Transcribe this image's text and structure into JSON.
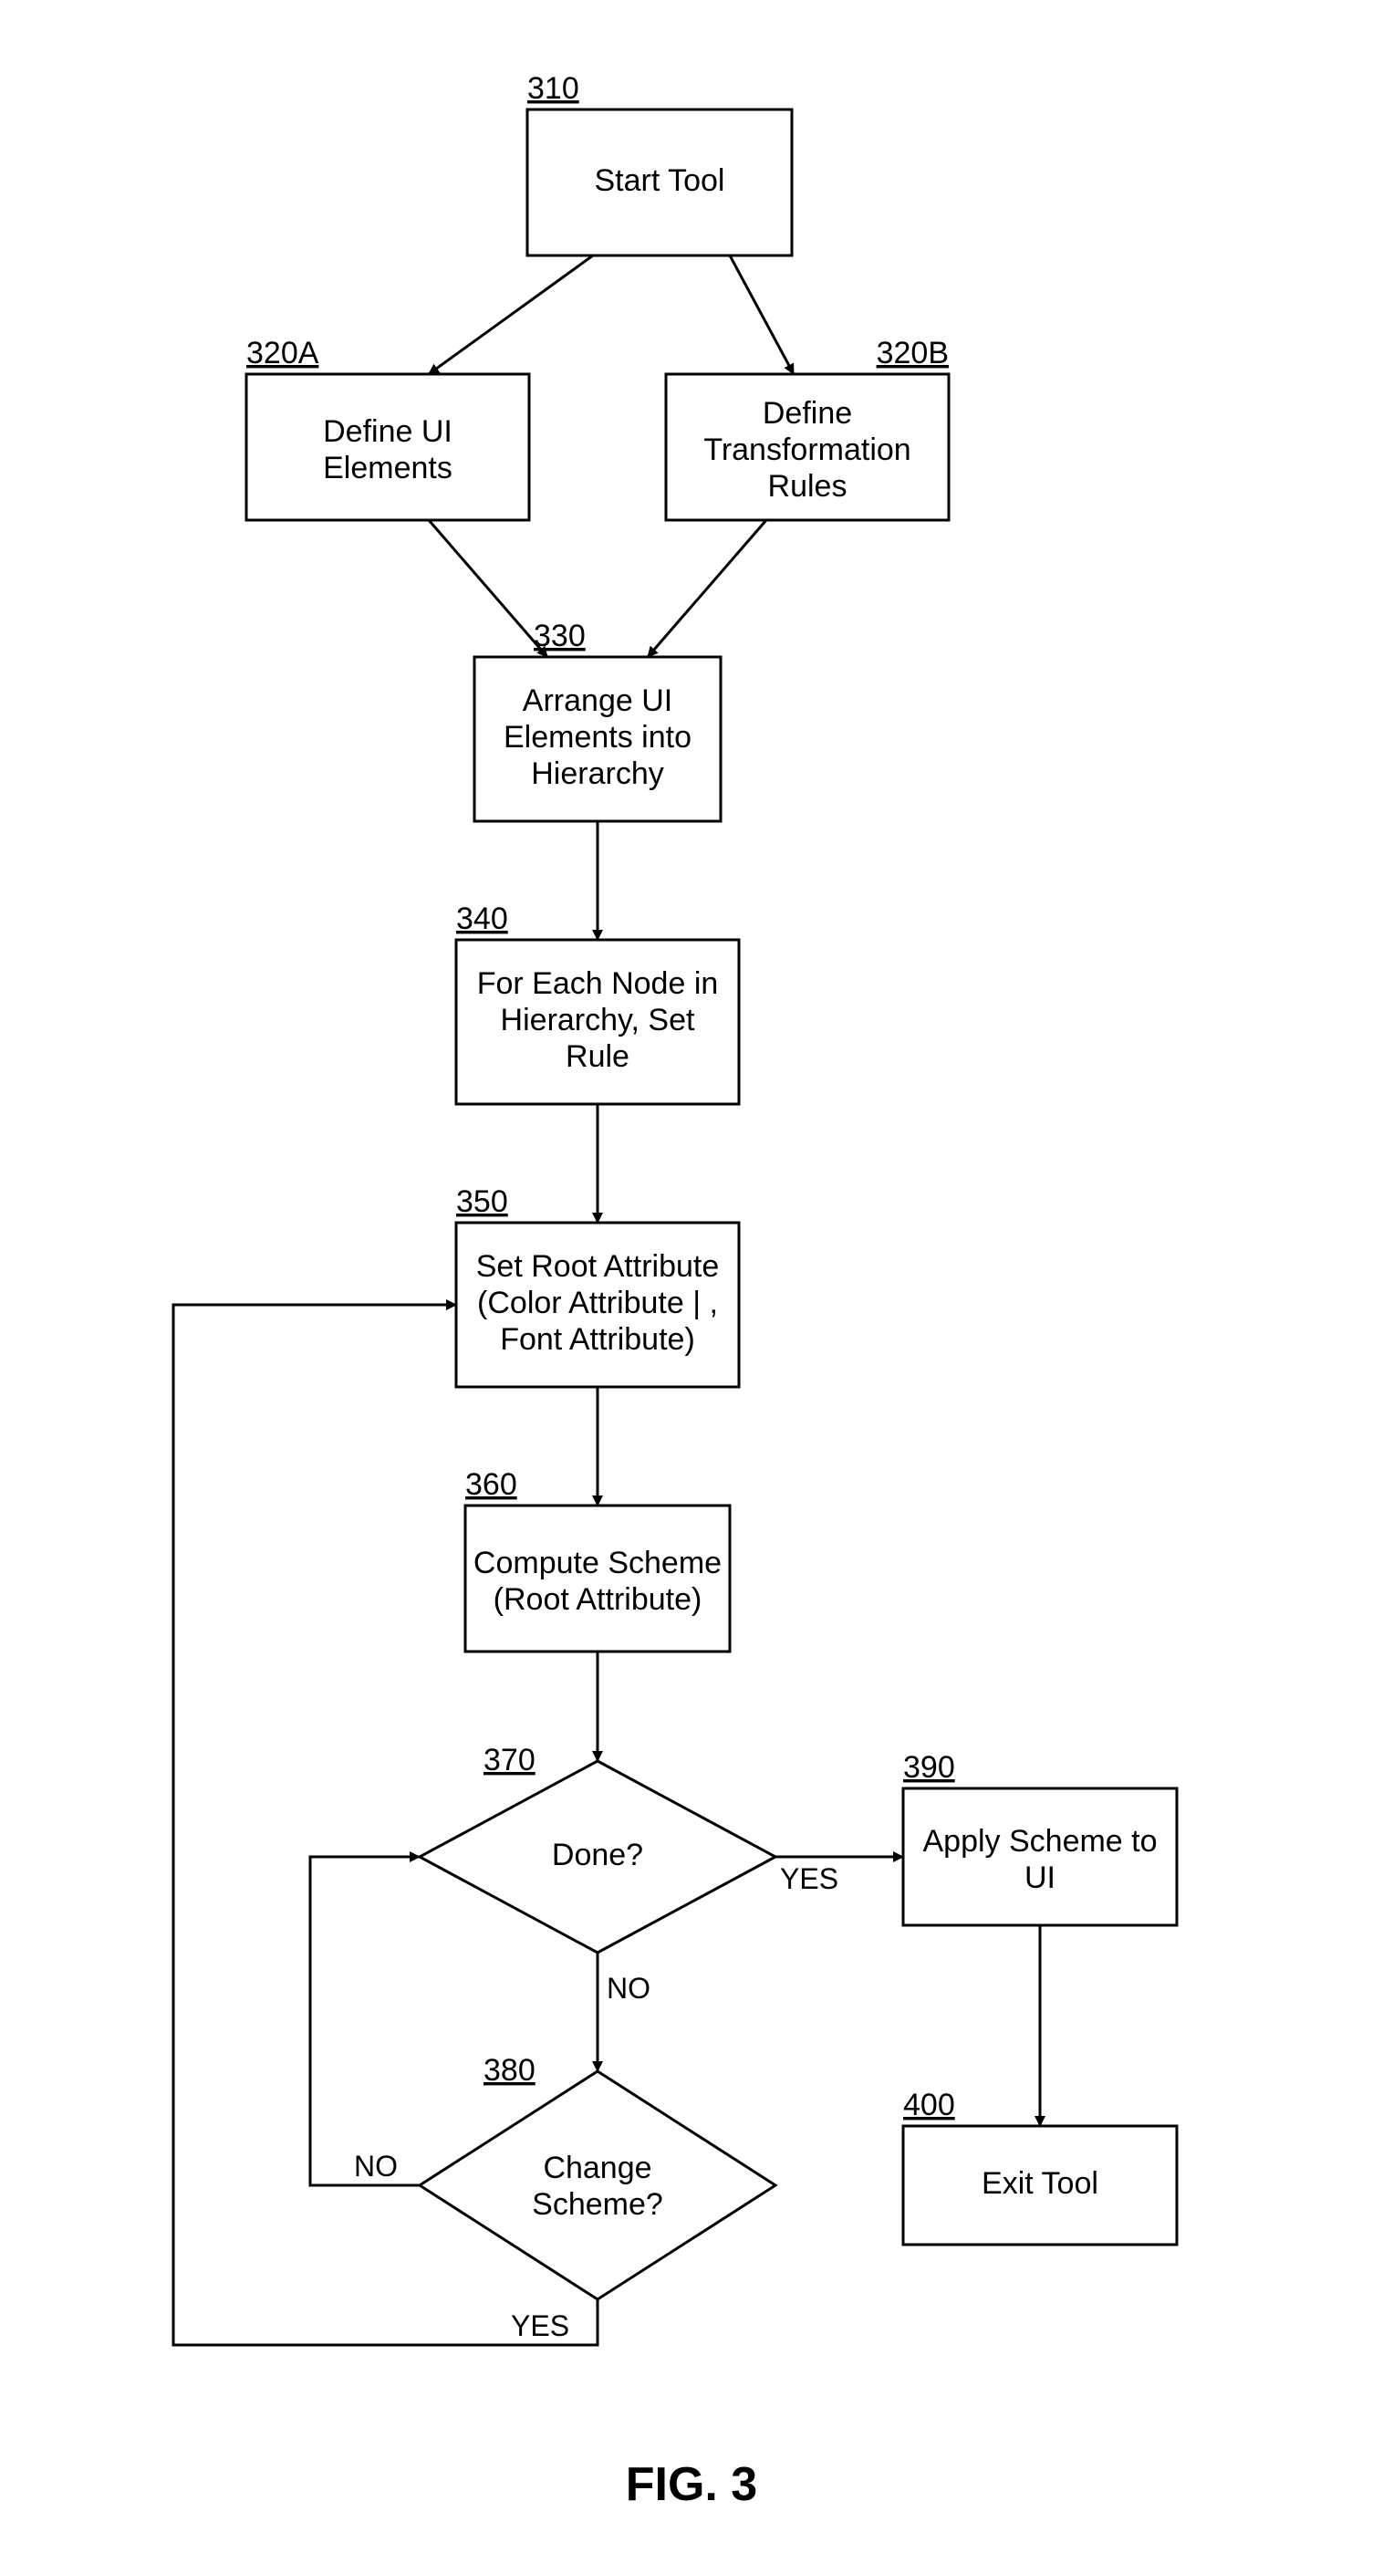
{
  "figure_label": "FIG. 3",
  "nodes": {
    "n310": {
      "num": "310",
      "lines": [
        "Start Tool"
      ]
    },
    "n320A": {
      "num": "320A",
      "lines": [
        "Define UI",
        "Elements"
      ]
    },
    "n320B": {
      "num": "320B",
      "lines": [
        "Define",
        "Transformation",
        "Rules"
      ]
    },
    "n330": {
      "num": "330",
      "lines": [
        "Arrange UI",
        "Elements into",
        "Hierarchy"
      ]
    },
    "n340": {
      "num": "340",
      "lines": [
        "For Each Node in",
        "Hierarchy, Set",
        "Rule"
      ]
    },
    "n350": {
      "num": "350",
      "lines": [
        "Set Root Attribute",
        "(Color Attribute | ,",
        "Font Attribute)"
      ]
    },
    "n360": {
      "num": "360",
      "lines": [
        "Compute Scheme",
        "(Root Attribute)"
      ]
    },
    "n370": {
      "num": "370",
      "lines": [
        "Done?"
      ]
    },
    "n380": {
      "num": "380",
      "lines": [
        "Change",
        "Scheme?"
      ]
    },
    "n390": {
      "num": "390",
      "lines": [
        "Apply Scheme to",
        "UI"
      ]
    },
    "n400": {
      "num": "400",
      "lines": [
        "Exit Tool"
      ]
    }
  },
  "edges": {
    "yes370": "YES",
    "no370": "NO",
    "yes380": "YES",
    "no380": "NO"
  }
}
